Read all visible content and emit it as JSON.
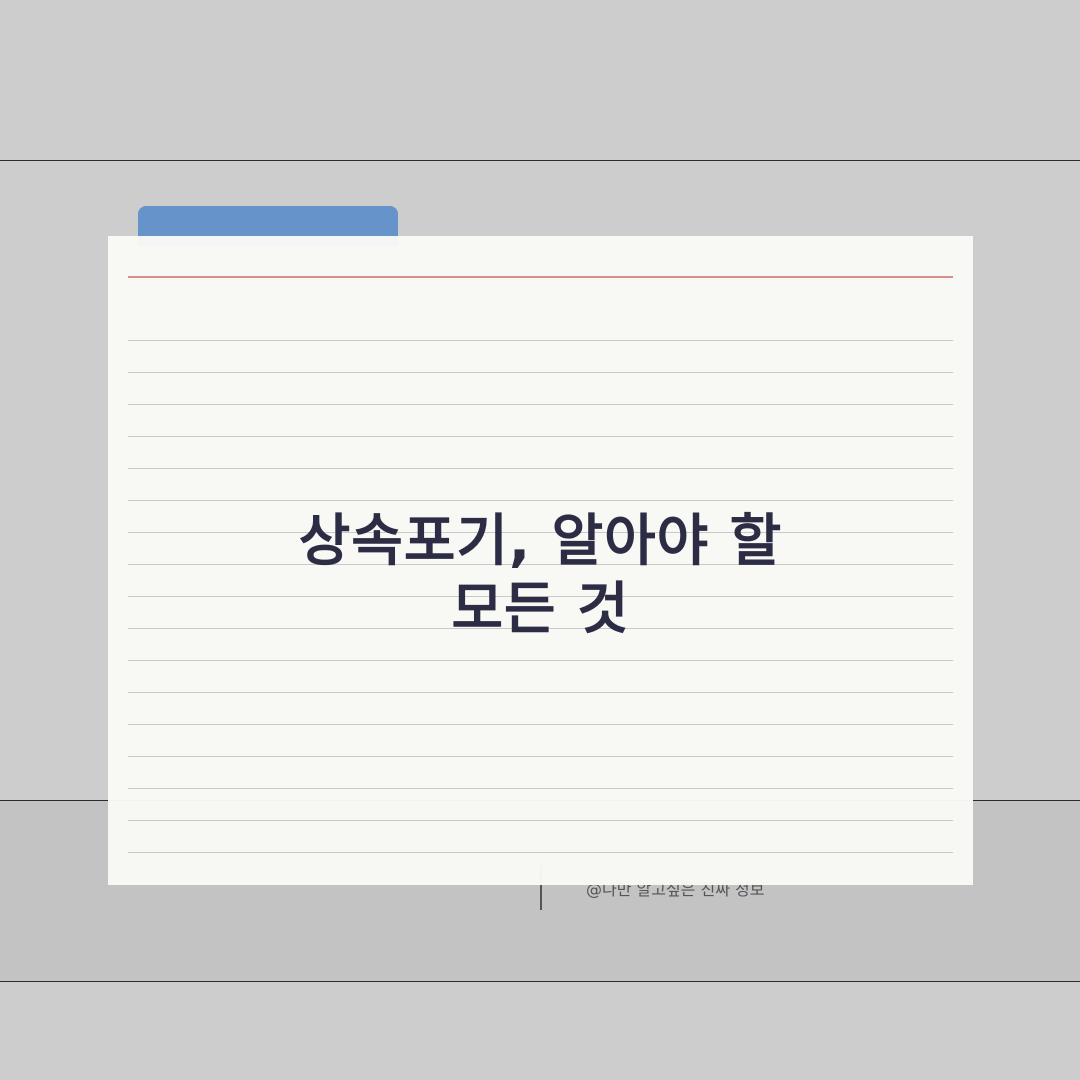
{
  "title": {
    "line1": "상속포기, 알아야 할",
    "line2": "모든 것"
  },
  "caption": "@나만 알고싶은 진짜 정보",
  "colors": {
    "background": "#cdcdcd",
    "tab": "#6693c9",
    "card": "#f9f9f6",
    "margin_line": "#d98e8e",
    "title": "#2c2d44"
  }
}
